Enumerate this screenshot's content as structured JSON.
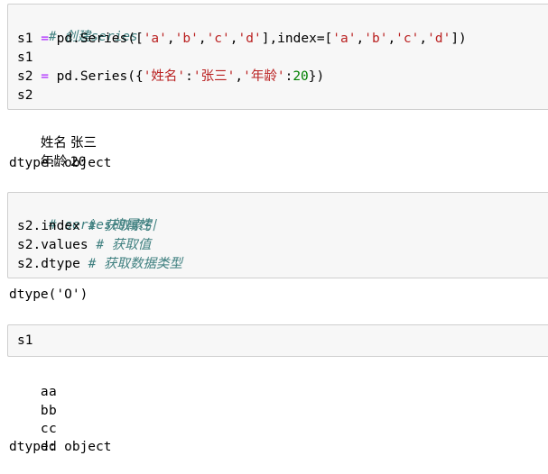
{
  "cells": [
    {
      "input": {
        "comment": "# 创建series",
        "line2": {
          "lhs": "s1",
          "eq": "=",
          "call": "pd.Series([",
          "a": "'a'",
          "b": "'b'",
          "c": "'c'",
          "d": "'d'",
          "mid": "],index=[",
          "a2": "'a'",
          "b2": "'b'",
          "c2": "'c'",
          "d2": "'d'",
          "end": "])"
        },
        "line3": "s1",
        "line4": {
          "lhs": "s2",
          "eq": "=",
          "call": "pd.Series({",
          "k1": "'姓名'",
          "colon1": ":",
          "v1": "'张三'",
          "comma": ",",
          "k2": "'年龄'",
          "colon2": ":",
          "v2": "20",
          "end": "})"
        },
        "line5": "s2"
      },
      "output": {
        "rows": [
          {
            "index": "姓名",
            "value": "张三"
          },
          {
            "index": "年龄",
            "value": "20"
          }
        ],
        "dtype": "dtype: object"
      }
    },
    {
      "input": {
        "comment": "# series的属性",
        "line2": {
          "code": "s2.index",
          "comment": "# 获取索引"
        },
        "line3": {
          "code": "s2.values",
          "comment": "# 获取值"
        },
        "line4": {
          "code": "s2.dtype",
          "comment": "# 获取数据类型"
        }
      },
      "output": {
        "text": "dtype('O')"
      }
    },
    {
      "input": {
        "line1": "s1"
      },
      "output": {
        "rows": [
          {
            "index": "a",
            "value": "a"
          },
          {
            "index": "b",
            "value": "b"
          },
          {
            "index": "c",
            "value": "c"
          },
          {
            "index": "d",
            "value": "d"
          }
        ],
        "dtype": "dtype: object"
      }
    }
  ],
  "colors": {
    "comment": "#408080",
    "operator": "#aa22ff",
    "string": "#ba2121",
    "number": "#008000",
    "cell_background": "#f7f7f7",
    "cell_border": "#cfcfcf"
  }
}
